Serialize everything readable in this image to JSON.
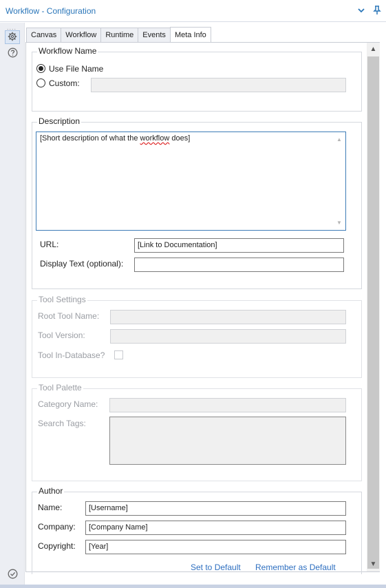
{
  "window": {
    "title": "Workflow - Configuration",
    "chevron_icon": "chevron-down-icon",
    "pin_icon": "pin-icon"
  },
  "rail": {
    "dots": "....",
    "items": [
      {
        "icon": "gear-icon",
        "active": true
      },
      {
        "icon": "help-icon",
        "active": false
      }
    ],
    "bottom_icon": "check-circle-icon"
  },
  "tabs": [
    {
      "label": "Canvas",
      "active": false
    },
    {
      "label": "Workflow",
      "active": false
    },
    {
      "label": "Runtime",
      "active": false
    },
    {
      "label": "Events",
      "active": false
    },
    {
      "label": "Meta Info",
      "active": true
    }
  ],
  "workflow_name": {
    "legend": "Workflow Name",
    "use_file_name_label": "Use File Name",
    "use_file_name_checked": true,
    "custom_label": "Custom:",
    "custom_value": ""
  },
  "description": {
    "legend": "Description",
    "text_before": "[Short description of what the ",
    "text_misspelled": "workflow",
    "text_after": " does]",
    "url_label": "URL:",
    "url_value": "[Link to Documentation]",
    "display_text_label": "Display Text (optional):",
    "display_text_value": ""
  },
  "tool_settings": {
    "legend": "Tool Settings",
    "root_tool_name_label": "Root Tool Name:",
    "tool_version_label": "Tool Version:",
    "tool_in_database_label": "Tool In-Database?"
  },
  "tool_palette": {
    "legend": "Tool Palette",
    "category_name_label": "Category Name:",
    "search_tags_label": "Search Tags:"
  },
  "author": {
    "legend": "Author",
    "name_label": "Name:",
    "name_value": "[Username]",
    "company_label": "Company:",
    "company_value": "[Company Name]",
    "copyright_label": "Copyright:",
    "copyright_value": "[Year]"
  },
  "footer": {
    "set_to_default": "Set to Default",
    "remember_as_default": "Remember as Default"
  },
  "colors": {
    "accent": "#2a76b9",
    "link": "#2e6fc0",
    "focus_border": "#3d7bb6"
  }
}
